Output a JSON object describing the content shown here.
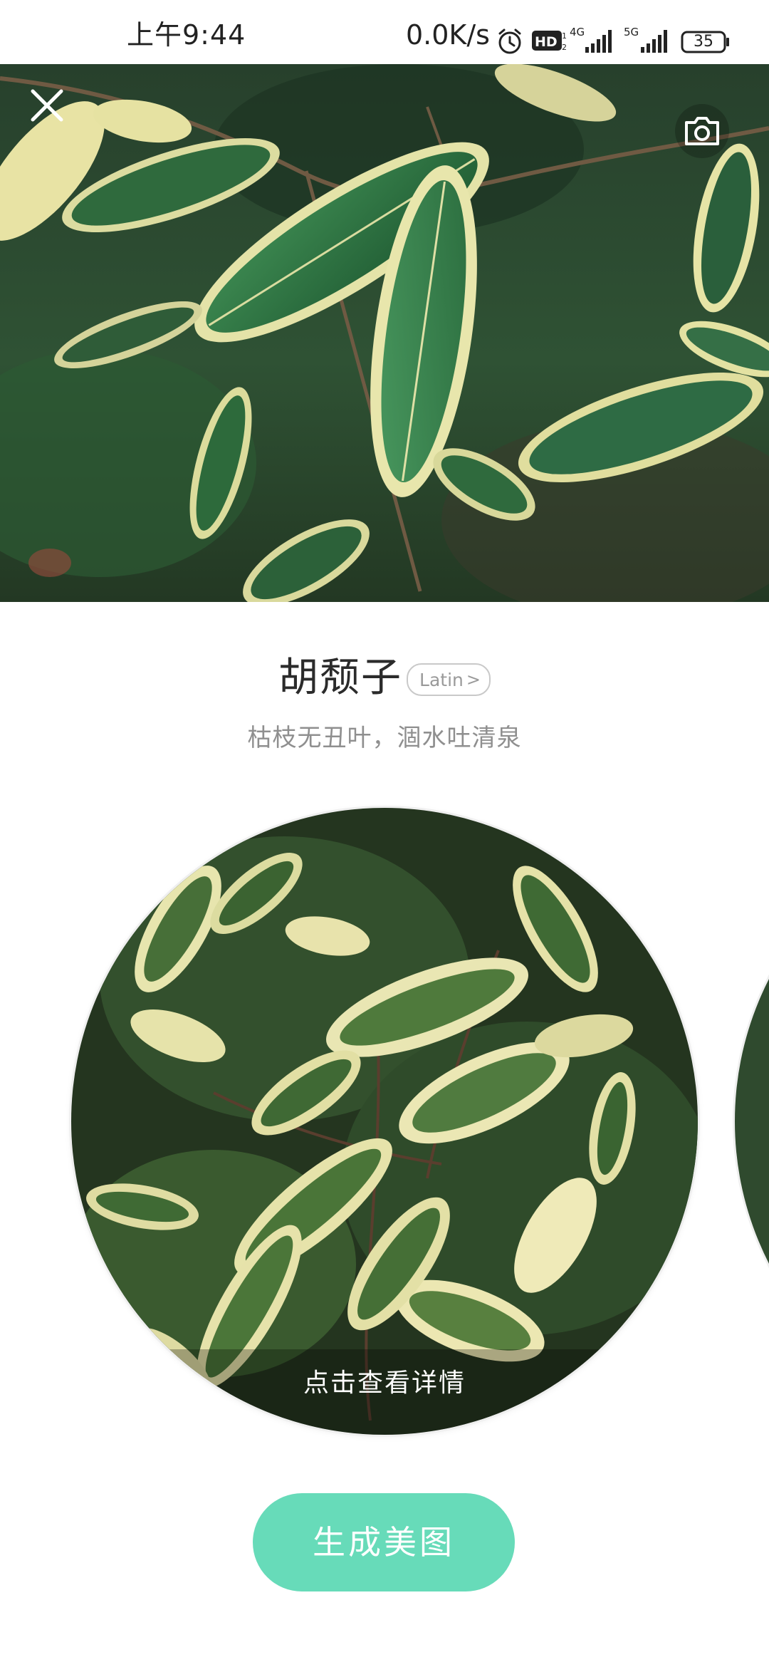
{
  "status_bar": {
    "time": "上午9:44",
    "net_speed": "0.0K/s",
    "battery_level": "35",
    "icons": [
      "alarm-icon",
      "hd-voice-icon",
      "signal-4g-icon",
      "signal-5g-icon",
      "battery-icon"
    ]
  },
  "header": {
    "close_icon": "close-icon",
    "camera_icon": "camera-icon"
  },
  "plant": {
    "name": "胡颓子",
    "latin_label": "Latin",
    "latin_chevron": ">",
    "poem": "枯枝无丑叶，涸水吐清泉"
  },
  "card": {
    "detail_label": "点击查看详情"
  },
  "actions": {
    "generate_label": "生成美图"
  },
  "colors": {
    "accent": "#67dbb9",
    "title_text": "#2b2b2b",
    "subtitle_text": "#8f8f8f"
  }
}
